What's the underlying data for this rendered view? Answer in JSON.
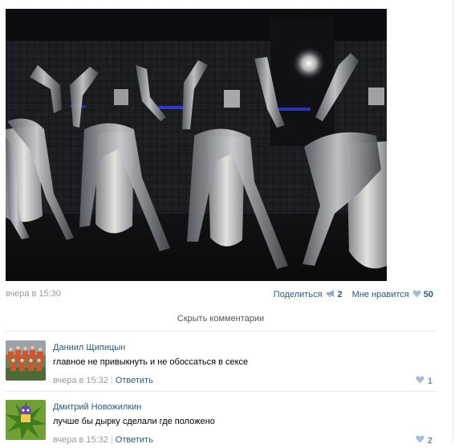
{
  "post": {
    "photo_icon": "photo-image",
    "date": "вчера в 15:30",
    "share": {
      "label": "Поделиться",
      "icon": "megaphone-icon",
      "count": "2"
    },
    "like": {
      "label": "Мне нравится",
      "icon": "heart-icon",
      "count": "50"
    }
  },
  "comments_toggle": "Скрыть комментарии",
  "comments": [
    {
      "author": "Даниил Щипицын",
      "text": "главное не привыкнуть и не обоссаться в сексе",
      "date": "вчера в 15:32",
      "separator": "|",
      "reply": "Ответить",
      "likes": "1"
    },
    {
      "author": "Дмитрий Новожилкин",
      "text": "лучше бы дырку сделали где положено",
      "date": "вчера в 15:32",
      "separator": "|",
      "reply": "Ответить",
      "likes": "2"
    }
  ],
  "colors": {
    "link": "#2b587a",
    "muted": "#999999",
    "like_blue": "#6d8fb3",
    "separator": "#e7eaed"
  }
}
